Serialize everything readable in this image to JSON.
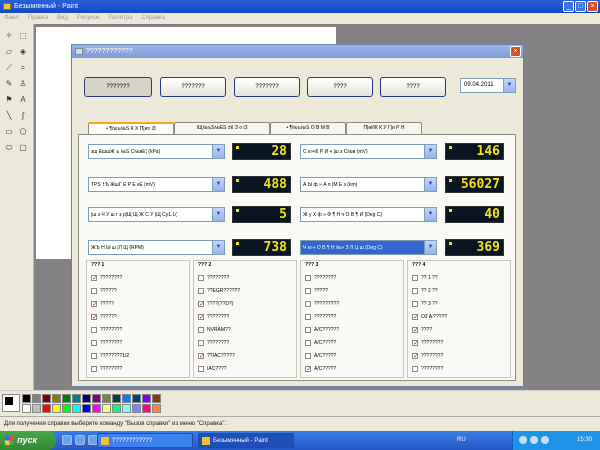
{
  "paint": {
    "title": "Безымянный - Paint",
    "menu": [
      "Файл",
      "Правка",
      "Вид",
      "Рисунок",
      "Палитра",
      "Справка"
    ],
    "status": "Для получения справки выберите команду \"Вызов справки\" из меню \"Справка\".",
    "palette": [
      "#000000",
      "#808080",
      "#800000",
      "#808000",
      "#008000",
      "#008080",
      "#000080",
      "#800080",
      "#808040",
      "#004040",
      "#0080ff",
      "#004080",
      "#8000ff",
      "#804000",
      "#ffffff",
      "#c0c0c0",
      "#ff0000",
      "#ffff00",
      "#00ff00",
      "#00ffff",
      "#0000ff",
      "#ff00ff",
      "#ffff80",
      "#00ff80",
      "#80ffff",
      "#8080ff",
      "#ff0080",
      "#ff8040"
    ]
  },
  "taskbar": {
    "start": "пуск",
    "tasks": [
      "????????????",
      "Безымянный - Paint"
    ],
    "lang": "RU",
    "clock": "15:30"
  },
  "dialog": {
    "title": "????????????",
    "buttons": [
      "???????",
      "???????",
      "???????",
      "????",
      "????"
    ],
    "date": "09.04.2011",
    "tabs": [
      "• ¶№ъ№Ѕ К Х П|и¤ іЗ",
      "ІЩ№ъЅ№ЕЅ ±К З ¤ іЗ",
      "• ¶№ъ№Ѕ О В М В",
      "П|иИК К У Г|и Р Н"
    ],
    "params": [
      {
        "label": "зш ЕшшЖ ъ №Ѕ С№вЕ¦ (kPa)",
        "value": "28"
      },
      {
        "label": "С к»ч6 Р И ч |ш з С№в (mV)",
        "value": "146"
      },
      {
        "label": "ТРS †Ъ ЖшГ Е Р Е кЕ (mV)",
        "value": "488"
      },
      {
        "label": "А Ы ф » А п |М Е з (km)",
        "value": "56027"
      },
      {
        "label": "|ш з Ч У ш г з р|Щ Щ Ж С У |Щ Су1.1(",
        "value": "5"
      },
      {
        "label": "Ж у Х ф » Ф ¶ Н ч О В ¶ И (Deg C)",
        "value": "40"
      },
      {
        "label": "ЖЪ Н Ы ш |Л Щ (RPM)",
        "value": "738"
      },
      {
        "label": "Ч к»» О В ¶ Н №» З Л Ц ш (Deg C)",
        "value": "369"
      }
    ],
    "groups": [
      {
        "title": "??? 1",
        "items": [
          {
            "label": "????????",
            "checked": true
          },
          {
            "label": "??????",
            "checked": false
          },
          {
            "label": "?????",
            "checked": true
          },
          {
            "label": "??????",
            "checked": true
          },
          {
            "label": "????????",
            "checked": false
          },
          {
            "label": "????????",
            "checked": false
          },
          {
            "label": "????????1/2",
            "checked": false
          },
          {
            "label": "????????",
            "checked": false
          }
        ]
      },
      {
        "title": "??? 2",
        "items": [
          {
            "label": "????????",
            "checked": false
          },
          {
            "label": "??EGR??????",
            "checked": false
          },
          {
            "label": "????(??D?)",
            "checked": true
          },
          {
            "label": "????????",
            "checked": true
          },
          {
            "label": "NVRAM??",
            "checked": false
          },
          {
            "label": "????????",
            "checked": false
          },
          {
            "label": "??IAC?????",
            "checked": true
          },
          {
            "label": "IAC????",
            "checked": false
          }
        ]
      },
      {
        "title": "??? 3",
        "items": [
          {
            "label": "????????",
            "checked": false
          },
          {
            "label": "?????",
            "checked": false
          },
          {
            "label": "?????????",
            "checked": false
          },
          {
            "label": "????????",
            "checked": false
          },
          {
            "label": "A/C??????",
            "checked": false
          },
          {
            "label": "A/C?????",
            "checked": false
          },
          {
            "label": "A/C?????",
            "checked": false
          },
          {
            "label": "A/C?????",
            "checked": true
          }
        ]
      },
      {
        "title": "??? 4",
        "items": [
          {
            "label": "?? 1 ??",
            "checked": false
          },
          {
            "label": "?? 2 ??",
            "checked": false
          },
          {
            "label": "?? 3 ??",
            "checked": false
          },
          {
            "label": "O2 A ?????",
            "checked": true
          },
          {
            "label": "????",
            "checked": true
          },
          {
            "label": "????????",
            "checked": true
          },
          {
            "label": "????????",
            "checked": true
          },
          {
            "label": "????????",
            "checked": false
          }
        ]
      }
    ]
  }
}
